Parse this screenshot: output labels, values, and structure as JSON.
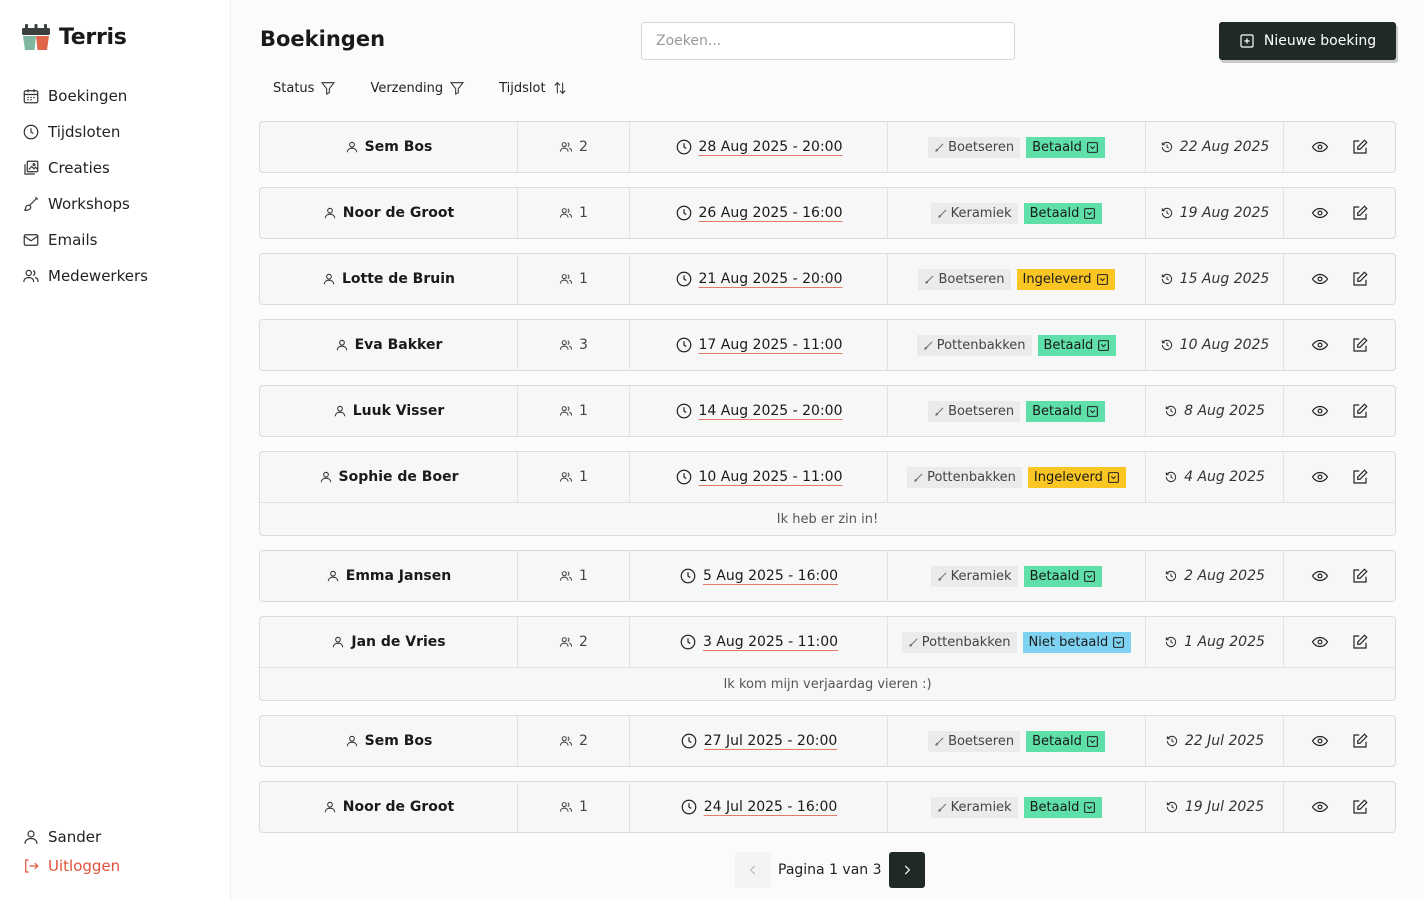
{
  "app": {
    "name": "Terris"
  },
  "sidebar": {
    "items": [
      {
        "label": "Boekingen",
        "icon": "calendar-icon"
      },
      {
        "label": "Tijdsloten",
        "icon": "clock-icon"
      },
      {
        "label": "Creaties",
        "icon": "gallery-icon"
      },
      {
        "label": "Workshops",
        "icon": "brush-icon"
      },
      {
        "label": "Emails",
        "icon": "mail-icon"
      },
      {
        "label": "Medewerkers",
        "icon": "users-icon"
      }
    ],
    "user": "Sander",
    "logout": "Uitloggen"
  },
  "header": {
    "title": "Boekingen",
    "search_placeholder": "Zoeken...",
    "new_button": "Nieuwe boeking"
  },
  "filters": {
    "status": "Status",
    "shipping": "Verzending",
    "slot": "Tijdslot"
  },
  "colors": {
    "accent": "#1f2a28",
    "paid": "#5ee0a8",
    "delivered": "#f9c623",
    "unpaid": "#7fd3f2",
    "logout": "#e0533a"
  },
  "bookings": [
    {
      "name": "Sem Bos",
      "people": "2",
      "slot": "28 Aug 2025 - 20:00",
      "workshop": "Boetseren",
      "status": "Betaald",
      "created": "22 Aug 2025",
      "note": ""
    },
    {
      "name": "Noor de Groot",
      "people": "1",
      "slot": "26 Aug 2025 - 16:00",
      "workshop": "Keramiek",
      "status": "Betaald",
      "created": "19 Aug 2025",
      "note": ""
    },
    {
      "name": "Lotte de Bruin",
      "people": "1",
      "slot": "21 Aug 2025 - 20:00",
      "workshop": "Boetseren",
      "status": "Ingeleverd",
      "created": "15 Aug 2025",
      "note": ""
    },
    {
      "name": "Eva Bakker",
      "people": "3",
      "slot": "17 Aug 2025 - 11:00",
      "workshop": "Pottenbakken",
      "status": "Betaald",
      "created": "10 Aug 2025",
      "note": ""
    },
    {
      "name": "Luuk Visser",
      "people": "1",
      "slot": "14 Aug 2025 - 20:00",
      "workshop": "Boetseren",
      "status": "Betaald",
      "created": "8 Aug 2025",
      "note": ""
    },
    {
      "name": "Sophie de Boer",
      "people": "1",
      "slot": "10 Aug 2025 - 11:00",
      "workshop": "Pottenbakken",
      "status": "Ingeleverd",
      "created": "4 Aug 2025",
      "note": "Ik heb er zin in!"
    },
    {
      "name": "Emma Jansen",
      "people": "1",
      "slot": "5 Aug 2025 - 16:00",
      "workshop": "Keramiek",
      "status": "Betaald",
      "created": "2 Aug 2025",
      "note": ""
    },
    {
      "name": "Jan de Vries",
      "people": "2",
      "slot": "3 Aug 2025 - 11:00",
      "workshop": "Pottenbakken",
      "status": "Niet betaald",
      "created": "1 Aug 2025",
      "note": "Ik kom mijn verjaardag vieren :)"
    },
    {
      "name": "Sem Bos",
      "people": "2",
      "slot": "27 Jul 2025 - 20:00",
      "workshop": "Boetseren",
      "status": "Betaald",
      "created": "22 Jul 2025",
      "note": ""
    },
    {
      "name": "Noor de Groot",
      "people": "1",
      "slot": "24 Jul 2025 - 16:00",
      "workshop": "Keramiek",
      "status": "Betaald",
      "created": "19 Jul 2025",
      "note": ""
    }
  ],
  "pagination": {
    "text": "Pagina 1 van 3"
  }
}
